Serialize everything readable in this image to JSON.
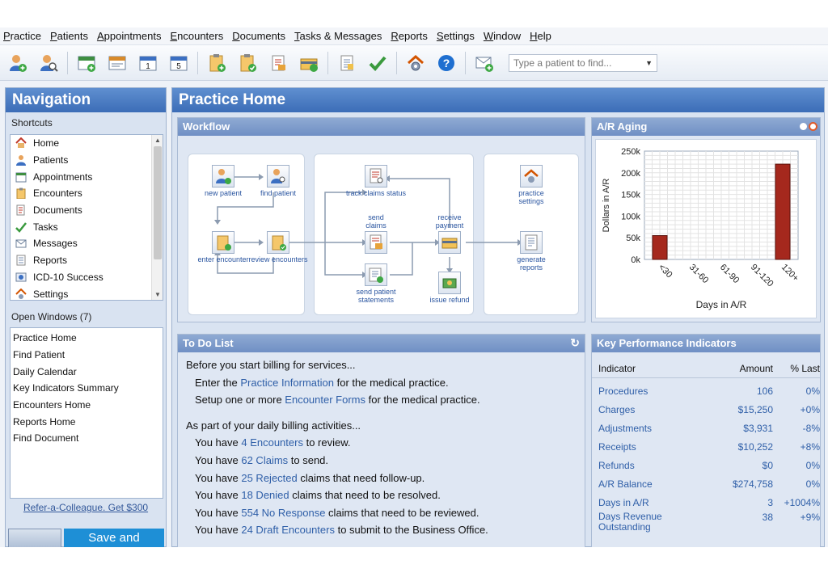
{
  "menu": [
    "Practice",
    "Patients",
    "Appointments",
    "Encounters",
    "Documents",
    "Tasks & Messages",
    "Reports",
    "Settings",
    "Window",
    "Help"
  ],
  "toolbar": {
    "icons": [
      "new-patient-icon",
      "find-patient-icon",
      "appointments-icon",
      "schedule-icon",
      "calendar-day-icon",
      "calendar-week-icon",
      "encounter-icon",
      "encounter-review-icon",
      "claims-icon",
      "payment-icon",
      "report-icon",
      "task-check-icon",
      "settings-icon",
      "help-icon",
      "message-icon"
    ],
    "search_placeholder": "Type a patient to find..."
  },
  "nav": {
    "title": "Navigation",
    "shortcuts_label": "Shortcuts",
    "shortcuts": [
      {
        "label": "Home",
        "icon": "home-icon"
      },
      {
        "label": "Patients",
        "icon": "patient-icon"
      },
      {
        "label": "Appointments",
        "icon": "calendar-icon"
      },
      {
        "label": "Encounters",
        "icon": "clipboard-icon"
      },
      {
        "label": "Documents",
        "icon": "document-icon"
      },
      {
        "label": "Tasks",
        "icon": "checkmark-icon"
      },
      {
        "label": "Messages",
        "icon": "envelope-icon"
      },
      {
        "label": "Reports",
        "icon": "report-icon"
      },
      {
        "label": "ICD-10 Success",
        "icon": "globe-icon"
      },
      {
        "label": "Settings",
        "icon": "gear-icon"
      }
    ],
    "open_windows_label": "Open Windows (7)",
    "open_windows": [
      "Practice Home",
      "Find Patient",
      "Daily Calendar",
      "Key Indicators Summary",
      "Encounters Home",
      "Reports Home",
      "Find Document"
    ],
    "refer_link": "Refer-a-Colleague. Get $300",
    "save_button": "Save and"
  },
  "main": {
    "title": "Practice Home",
    "workflow": {
      "title": "Workflow",
      "nodes": {
        "new_patient": "new patient",
        "find_patient": "find patient",
        "enter_encounter": "enter encounter",
        "review_encounters": "review encounters",
        "track_claims": "track claims status",
        "send_claims": "send claims",
        "send_statements": "send patient statements",
        "receive_payment": "receive payment",
        "issue_refund": "issue refund",
        "practice_settings": "practice settings",
        "generate_reports": "generate reports"
      }
    },
    "ar_aging": {
      "title": "A/R Aging"
    },
    "todo": {
      "title": "To Do List",
      "intro1": "Before you start billing for services...",
      "enter_the": "Enter the ",
      "practice_info": "Practice Information",
      "for_med": " for the medical practice.",
      "setup": "Setup one or more ",
      "encounter_forms": "Encounter Forms",
      "for_med2": " for the medical practice.",
      "intro2": "As part of your daily billing activities...",
      "you_have": "You have ",
      "l1_link": "4 Encounters",
      "l1_rest": " to review.",
      "l2_link": "62 Claims",
      "l2_rest": " to send.",
      "l3_link": "25 Rejected",
      "l3_rest": " claims that need follow-up.",
      "l4_link": "18 Denied",
      "l4_rest": " claims that need to be resolved.",
      "l5_link": "554 No Response",
      "l5_rest": " claims that need to be reviewed.",
      "l6_link": "24 Draft Encounters",
      "l6_rest": " to submit to the Business Office."
    },
    "kpi": {
      "title": "Key Performance Indicators",
      "headers": [
        "Indicator",
        "Amount",
        "% Last"
      ],
      "rows": [
        [
          "Procedures",
          "106",
          "0%"
        ],
        [
          "Charges",
          "$15,250",
          "+0%"
        ],
        [
          "Adjustments",
          "$3,931",
          "-8%"
        ],
        [
          "Receipts",
          "$10,252",
          "+8%"
        ],
        [
          "Refunds",
          "$0",
          "0%"
        ],
        [
          "A/R Balance",
          "$274,758",
          "0%"
        ],
        [
          "Days in A/R",
          "3",
          "+1004%"
        ],
        [
          "Days Revenue Outstanding",
          "38",
          "+9%"
        ]
      ]
    }
  },
  "chart_data": {
    "type": "bar",
    "title": "",
    "categories": [
      "<30",
      "31-60",
      "61-90",
      "91-120",
      "120+"
    ],
    "values": [
      55000,
      0,
      0,
      0,
      220000
    ],
    "xlabel": "Days in A/R",
    "ylabel": "Dollars in A/R",
    "ylim": [
      0,
      250000
    ],
    "yticks": [
      "0k",
      "50k",
      "100k",
      "150k",
      "200k",
      "250k"
    ],
    "grid": true,
    "bar_color": "#a5281d"
  }
}
